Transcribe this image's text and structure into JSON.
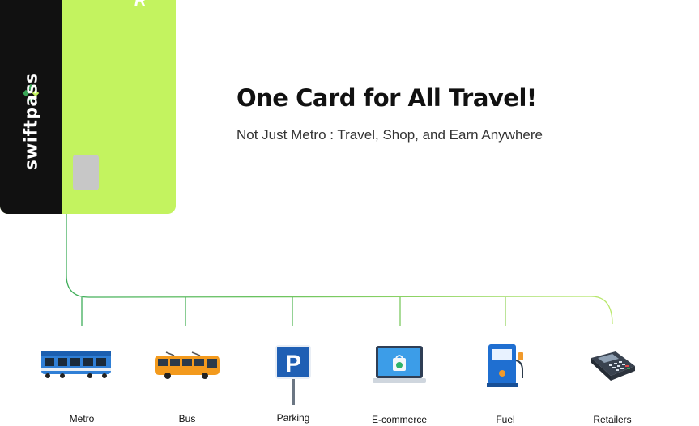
{
  "card": {
    "brand": "swiftpass",
    "corner_text": "R",
    "colors": {
      "card": "#c3f35f",
      "strip": "#111111",
      "chip": "#c7c7c7",
      "logo": "#3aa657"
    }
  },
  "headline": {
    "title": "One Card for All Travel!",
    "subtitle": "Not Just Metro : Travel, Shop, and Earn Anywhere"
  },
  "connector_color": "#3fae5a",
  "categories": [
    {
      "label": "Metro",
      "icon": "metro-train-icon"
    },
    {
      "label": "Bus",
      "icon": "bus-icon"
    },
    {
      "label": "Parking",
      "icon": "parking-sign-icon"
    },
    {
      "label": "E-commerce",
      "icon": "laptop-shopping-bag-icon"
    },
    {
      "label": "Fuel",
      "icon": "fuel-pump-icon"
    },
    {
      "label": "Retailers",
      "icon": "card-payment-terminal-icon"
    }
  ]
}
